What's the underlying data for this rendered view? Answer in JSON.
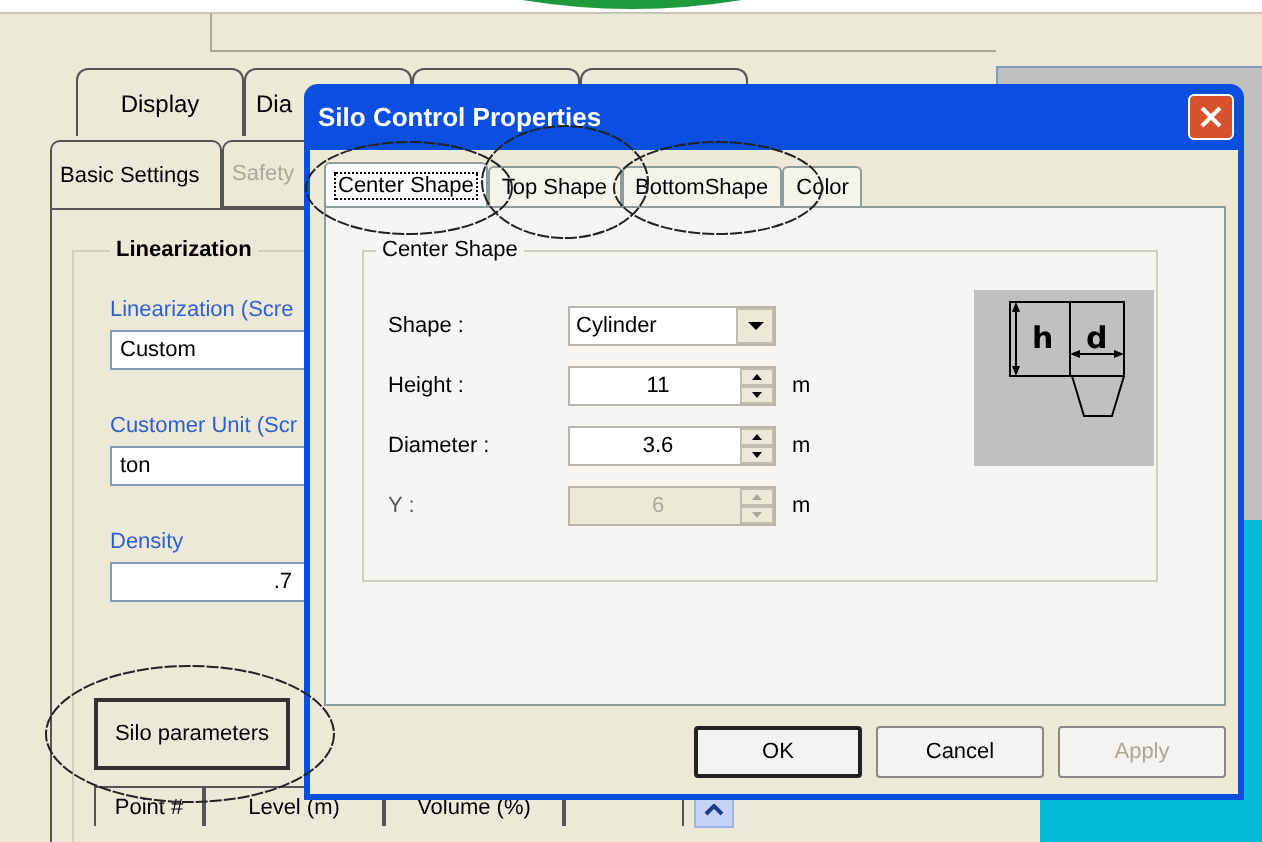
{
  "background_window": {
    "tabs": [
      {
        "label": "Display",
        "selected": false
      },
      {
        "label": "Dia",
        "selected": false
      }
    ],
    "sub_tabs": [
      {
        "label": "Basic Settings",
        "selected": true,
        "disabled": false
      },
      {
        "label": "Safety",
        "selected": false,
        "disabled": true
      }
    ],
    "group_title": "Linearization",
    "fields": [
      {
        "label": "Linearization (Scre",
        "value": "Custom",
        "kind": "text"
      },
      {
        "label": "Customer Unit (Scr",
        "value": "ton",
        "kind": "text"
      },
      {
        "label": "Density",
        "value": ".7",
        "kind": "number"
      }
    ],
    "button": "Silo parameters",
    "table_columns": [
      "Point #",
      "Level (m)",
      "Volume (%)"
    ]
  },
  "dialog": {
    "title": "Silo Control Properties",
    "tabs": [
      {
        "label": "Center Shape",
        "selected": true
      },
      {
        "label": "Top Shape",
        "selected": false
      },
      {
        "label": "BottomShape",
        "selected": false
      },
      {
        "label": "Color",
        "selected": false
      }
    ],
    "group_title": "Center Shape",
    "rows": [
      {
        "label": "Shape :",
        "kind": "combo",
        "value": "Cylinder",
        "disabled": false
      },
      {
        "label": "Height :",
        "kind": "spin",
        "value": "11",
        "unit": "m",
        "disabled": false
      },
      {
        "label": "Diameter :",
        "kind": "spin",
        "value": "3.6",
        "unit": "m",
        "disabled": false
      },
      {
        "label": "Y :",
        "kind": "spin",
        "value": "6",
        "unit": "m",
        "disabled": true
      }
    ],
    "diagram_labels": [
      "h",
      "d"
    ],
    "buttons": [
      {
        "label": "OK",
        "default": true,
        "disabled": false
      },
      {
        "label": "Cancel",
        "default": false,
        "disabled": false
      },
      {
        "label": "Apply",
        "default": false,
        "disabled": true
      }
    ]
  }
}
